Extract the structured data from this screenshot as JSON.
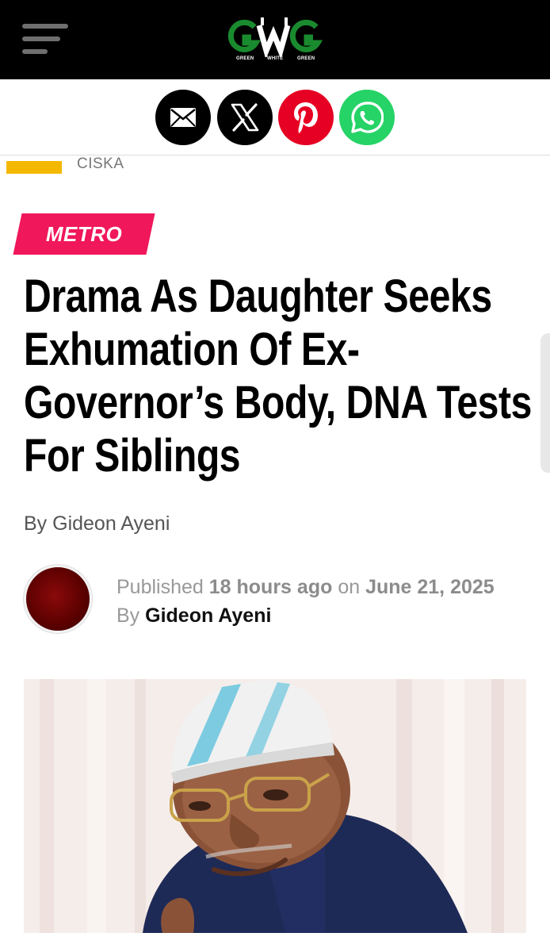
{
  "header": {
    "menu_icon": "hamburger-menu-icon",
    "logo": {
      "letters": "GWG",
      "sub_labels": [
        "GREEN",
        "WHITE",
        "GREEN"
      ],
      "colors": {
        "green": "#1a8a2e",
        "white": "#ffffff"
      }
    }
  },
  "share": {
    "buttons": [
      {
        "name": "email",
        "icon": "envelope-icon",
        "color": "#000000"
      },
      {
        "name": "x",
        "icon": "x-logo-icon",
        "color": "#000000"
      },
      {
        "name": "pinterest",
        "icon": "pinterest-icon",
        "color": "#e60023"
      },
      {
        "name": "whatsapp",
        "icon": "whatsapp-icon",
        "color": "#25d366"
      }
    ]
  },
  "ticker": {
    "text": "CISKA",
    "accent_color": "#f5b800"
  },
  "article": {
    "category": "METRO",
    "category_color": "#f0175a",
    "title": "Drama As Daughter Seeks Exhumation Of Ex-Governor’s Body, DNA Tests For Siblings",
    "byline": "By Gideon Ayeni",
    "meta": {
      "published_label": "Published",
      "relative_time": "18 hours ago",
      "on_label": "on",
      "date": "June 21, 2025",
      "by_label": "By",
      "author": "Gideon Ayeni"
    },
    "image_description_icon": "featured-photo"
  }
}
